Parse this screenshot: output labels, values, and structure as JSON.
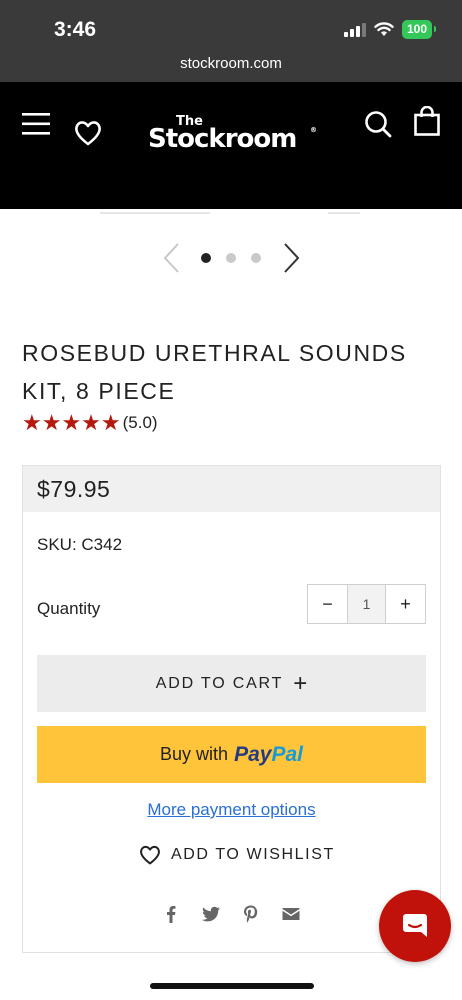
{
  "status_bar": {
    "time": "3:46",
    "battery": "100",
    "url": "stockroom.com"
  },
  "header": {
    "logo_small": "The",
    "logo_main": "Stockroom",
    "logo_reg": "®",
    "icons": [
      "menu-icon",
      "heart-icon",
      "search-icon",
      "shopping-bag-icon"
    ]
  },
  "carousel": {
    "slide_count": 3,
    "active_index": 0
  },
  "product": {
    "title": "ROSEBUD URETHRAL SOUNDS KIT, 8 PIECE",
    "stars": "★★★★★",
    "rating_text": "(5.0)",
    "price": "$79.95",
    "sku": "SKU: C342",
    "quantity_label": "Quantity",
    "quantity_value": "1",
    "minus": "−",
    "plus": "+"
  },
  "actions": {
    "add_to_cart": "ADD TO CART",
    "add_to_cart_icon": "+",
    "paypal_prefix": "Buy with",
    "paypal_pay": "Pay",
    "paypal_pal": "Pal",
    "more_payment": "More payment options",
    "wishlist": "ADD TO WISHLIST"
  },
  "social": [
    "facebook-icon",
    "twitter-icon",
    "pinterest-icon",
    "email-icon"
  ],
  "colors": {
    "header_bg": "#000000",
    "status_bg": "#3a3a3a",
    "star_red": "#b5190d",
    "paypal_yellow": "#ffc439",
    "link_blue": "#2a6fd6",
    "chat_red": "#c0120a"
  }
}
